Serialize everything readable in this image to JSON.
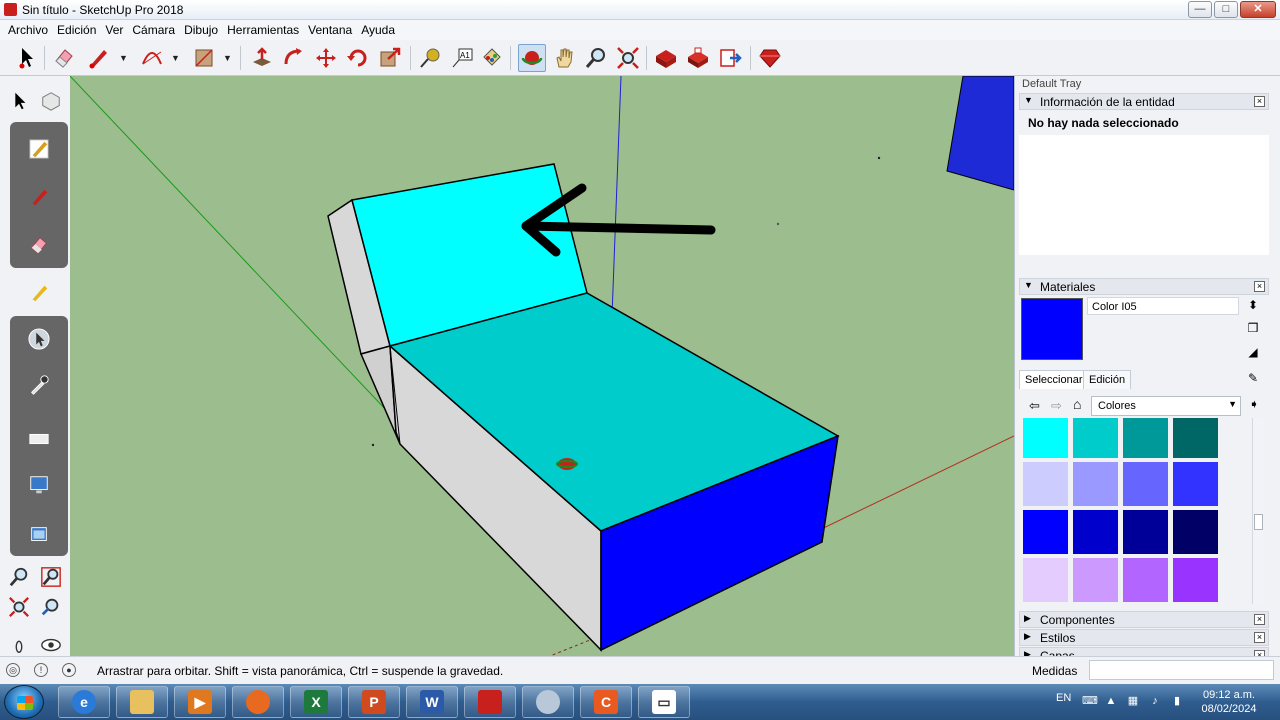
{
  "window": {
    "title": "Sin título - SketchUp Pro 2018",
    "min": "—",
    "max": "□",
    "close": "✕"
  },
  "menu": [
    "Archivo",
    "Edición",
    "Ver",
    "Cámara",
    "Dibujo",
    "Herramientas",
    "Ventana",
    "Ayuda"
  ],
  "toolbar": {
    "tools": [
      "select-tool",
      "eraser-tool",
      "line-tool",
      "arc-tool",
      "shape-tool",
      "push-pull-tool",
      "follow-me-tool",
      "move-tool",
      "rotate-tool",
      "scale-tool",
      "tape-measure-tool",
      "text-tool",
      "paint-bucket-tool",
      "orbit-tool",
      "pan-tool",
      "zoom-tool",
      "zoom-extents-tool",
      "3d-warehouse-tool",
      "extension-warehouse-tool",
      "send-to-layout-tool",
      "ruby-extension-tool"
    ],
    "text_tool_glyph": "A1"
  },
  "tray": {
    "title": "Default Tray",
    "entity_panel": {
      "title": "Información de la entidad",
      "message": "No hay nada seleccionado"
    },
    "materials_panel": {
      "title": "Materiales",
      "material_name": "Color I05",
      "current_color": "#0000ff",
      "tabs": [
        "Seleccionar",
        "Edición"
      ],
      "active_tab": "Seleccionar",
      "library": "Colores",
      "swatches": [
        [
          "#00ffff",
          "#00cccc",
          "#009999",
          "#006666"
        ],
        [
          "#ccccff",
          "#9999ff",
          "#6666ff",
          "#3333ff"
        ],
        [
          "#0000ff",
          "#0000cc",
          "#000099",
          "#000066"
        ],
        [
          "#e5ccff",
          "#cc99ff",
          "#b266ff",
          "#9933ff"
        ],
        [
          "#8000ff",
          "#6600cc",
          "#4d0099",
          "#330066"
        ]
      ]
    },
    "collapsed_panels": [
      "Componentes",
      "Estilos",
      "Capas"
    ]
  },
  "status": {
    "message": "Arrastrar para orbitar. Shift = vista panorámica, Ctrl = suspende la gravedad.",
    "measurements_label": "Medidas",
    "measurements_value": ""
  },
  "taskbar": {
    "apps": [
      "internet-explorer",
      "file-explorer",
      "media-player",
      "firefox",
      "excel",
      "powerpoint",
      "word",
      "sketchup",
      "sketchup-tool",
      "app-c",
      "chat"
    ],
    "app_glyphs": {
      "excel": "X",
      "powerpoint": "P",
      "word": "W",
      "app-c": "C"
    },
    "language": "EN",
    "time": "09:12 a.m.",
    "date": "08/02/2024"
  },
  "colors": {
    "viewport_bg": "#9cbd8d",
    "backrest_top": "#00ffff",
    "seat_top": "#00cccc",
    "front_face": "#0000ff",
    "side_face": "#d8d8d8"
  }
}
